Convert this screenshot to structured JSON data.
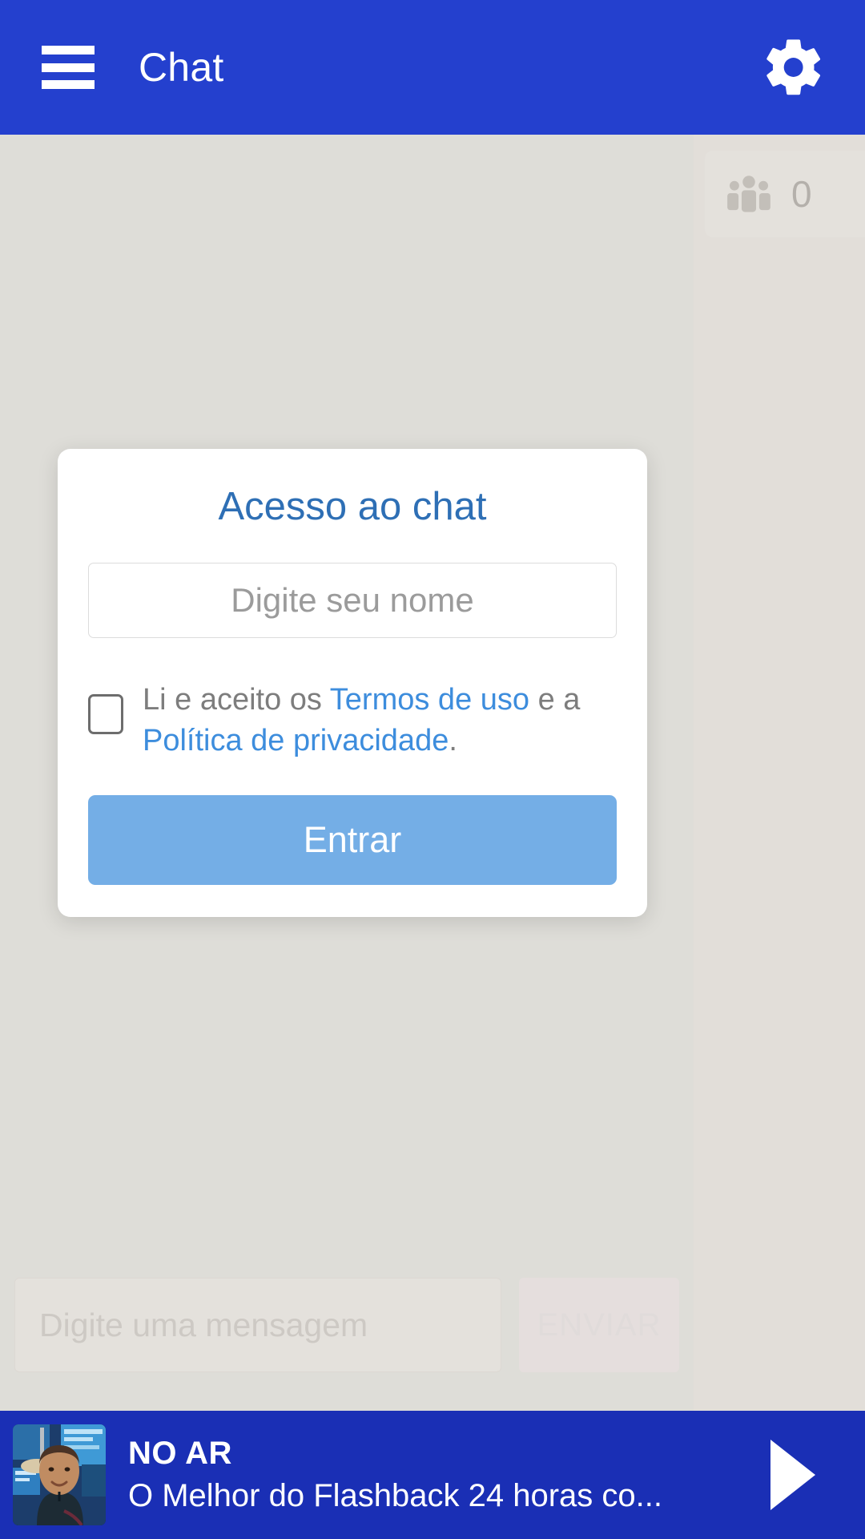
{
  "header": {
    "menu_icon": "hamburger-menu-icon",
    "title": "Chat",
    "settings_icon": "gear-icon",
    "background_color": "#2440ce"
  },
  "chat": {
    "users_icon": "people-group-icon",
    "users_count": "0",
    "composer_placeholder": "Digite uma mensagem",
    "send_label": "ENVIAR",
    "background_color": "#dedad5"
  },
  "modal": {
    "title": "Acesso ao chat",
    "title_color": "#2e6fb5",
    "name_placeholder": "Digite seu nome",
    "name_value": "",
    "terms": {
      "prefix": "Li e aceito os ",
      "link_terms": "Termos de uso",
      "middle": " e a ",
      "link_privacy": "Política de privacidade",
      "suffix": ".",
      "checked": false,
      "link_color": "#3d8ddd"
    },
    "submit_label": "Entrar",
    "submit_color": "#74aee6"
  },
  "player": {
    "thumbnail": "radio-host-studio-photo",
    "live_label": "NO AR",
    "program": "O Melhor do Flashback 24 horas co...",
    "play_icon": "play-icon",
    "background_color": "#1a2fb5"
  }
}
